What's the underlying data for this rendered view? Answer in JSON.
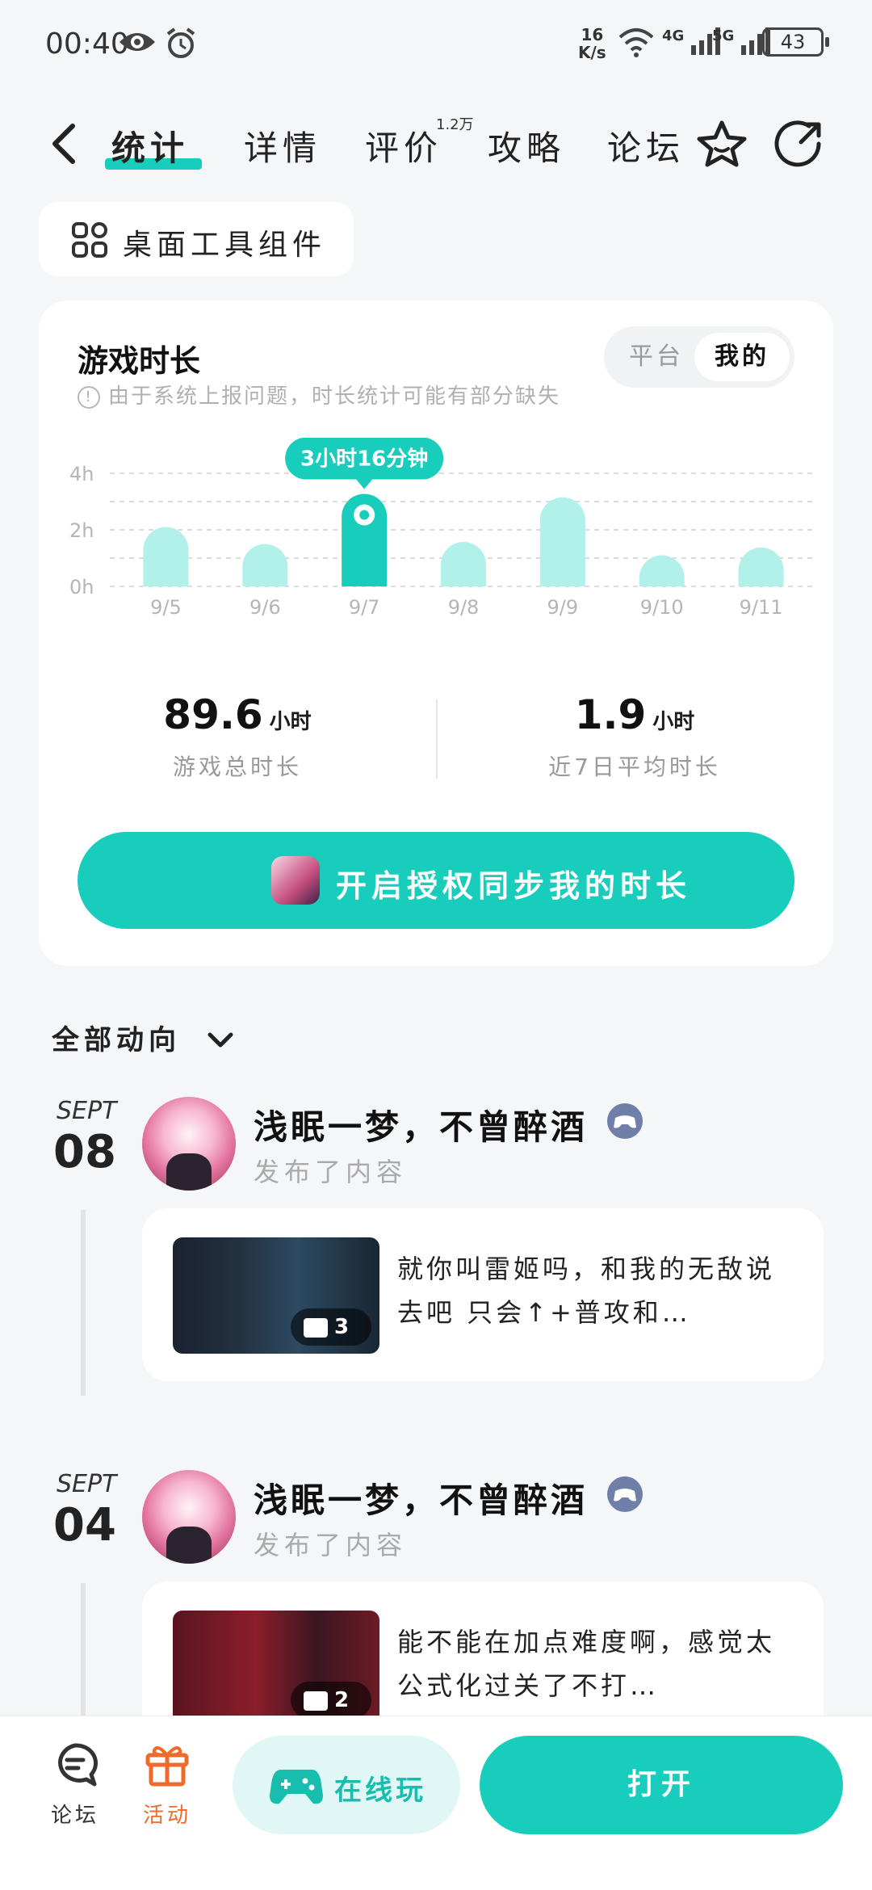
{
  "status_bar": {
    "time": "00:40",
    "net_speed_value": "16",
    "net_speed_unit": "K/s",
    "battery": "43",
    "signal_4g": "4G",
    "signal_5g": "5G"
  },
  "nav": {
    "tabs": [
      {
        "label": "统计",
        "active": true
      },
      {
        "label": "详情"
      },
      {
        "label": "评价"
      },
      {
        "label": "攻略"
      },
      {
        "label": "论坛"
      }
    ],
    "review_badge": "1.2万"
  },
  "widget_chip": {
    "label": "桌面工具组件"
  },
  "stats": {
    "title": "游戏时长",
    "note": "由于系统上报问题，时长统计可能有部分缺失",
    "toggle": {
      "platform": "平台",
      "mine": "我的",
      "selected": "我的"
    },
    "total_value": "89.6",
    "total_unit": "小时",
    "total_label": "游戏总时长",
    "avg_value": "1.9",
    "avg_unit": "小时",
    "avg_label": "近7日平均时长",
    "sync_button": "开启授权同步我的时长"
  },
  "chart_data": {
    "type": "bar",
    "categories": [
      "9/5",
      "9/6",
      "9/7",
      "9/8",
      "9/9",
      "9/10",
      "9/11"
    ],
    "values": [
      2.1,
      1.4,
      3.27,
      1.55,
      3.15,
      0.6,
      1.15
    ],
    "ylim": [
      0,
      4
    ],
    "yticks": [
      "0h",
      "2h",
      "4h"
    ],
    "highlight_index": 2,
    "highlight_label": "3小时16分钟",
    "colors": {
      "bar": "#b2f0ea",
      "highlight": "#19cdbc"
    },
    "grid": true
  },
  "feed": {
    "header": "全部动向",
    "posts": [
      {
        "month": "SEPT",
        "day": "08",
        "username": "浅眠一梦，不曾醉酒",
        "action": "发布了内容",
        "snippet": "就你叫雷姬吗，和我的无敌说去吧 只会↑+普攻和…",
        "image_count": "3"
      },
      {
        "month": "SEPT",
        "day": "04",
        "username": "浅眠一梦，不曾醉酒",
        "action": "发布了内容",
        "snippet": "能不能在加点难度啊，感觉太公式化过关了不打…",
        "image_count": "2"
      }
    ]
  },
  "bottom_bar": {
    "forum": "论坛",
    "activity": "活动",
    "online_play": "在线玩",
    "open": "打开"
  },
  "colors": {
    "accent": "#19cdbc",
    "activity": "#f06a2a",
    "background": "#f5f6f8"
  }
}
